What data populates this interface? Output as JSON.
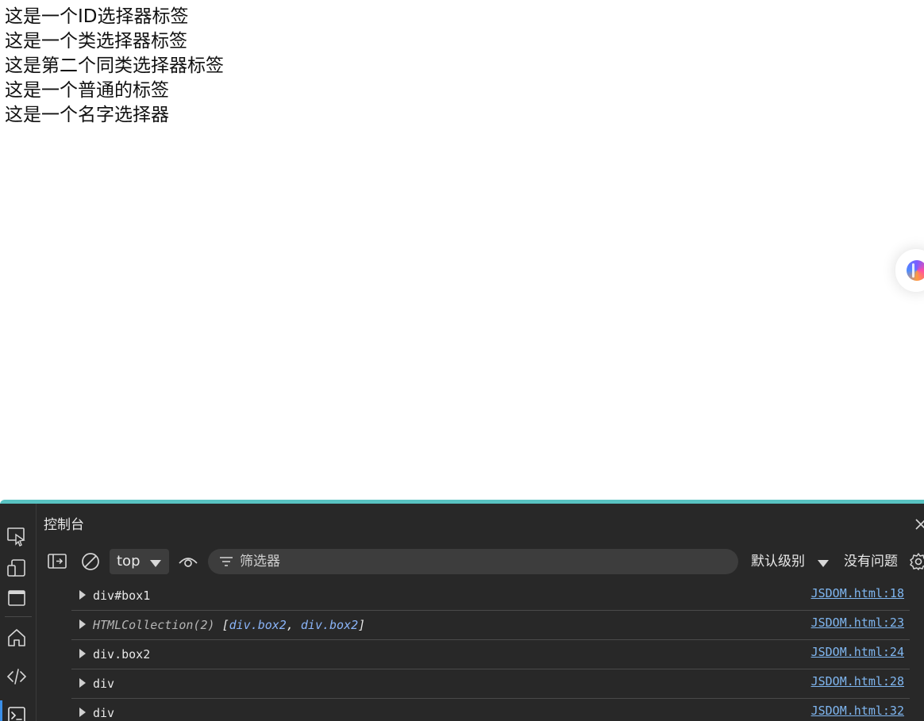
{
  "page": {
    "lines": [
      "这是一个ID选择器标签",
      "这是一个类选择器标签",
      "这是第二个同类选择器标签",
      "这是一个普通的标签",
      "这是一个名字选择器"
    ]
  },
  "devtools": {
    "title": "控制台",
    "toolbar": {
      "context": "top",
      "filter_placeholder": "筛选器",
      "levels": "默认级别",
      "issues": "没有问题"
    },
    "logs": [
      {
        "message": "div#box1",
        "source": "JSDOM.html:18"
      },
      {
        "message_prefix": "HTMLCollection(2) ",
        "bracket_open": "[",
        "item1_tag": "div",
        "item1_cls": ".box2",
        "sep": ", ",
        "item2_tag": "div",
        "item2_cls": ".box2",
        "bracket_close": "]",
        "source": "JSDOM.html:23"
      },
      {
        "message": "div.box2",
        "source": "JSDOM.html:24"
      },
      {
        "message": "div",
        "source": "JSDOM.html:28"
      },
      {
        "message": "div",
        "source": "JSDOM.html:32"
      }
    ]
  },
  "colors": {
    "accent_border": "#58c2c1",
    "devtools_bg": "#282828",
    "link": "#7fb6f0"
  },
  "icons": {
    "activity_bar": [
      "inspect-icon",
      "device-emulation-icon",
      "window-icon",
      "home-icon",
      "code-icon",
      "console-icon"
    ],
    "toolbar": [
      "sidebar-toggle-icon",
      "clear-icon",
      "eye-icon",
      "filter-icon",
      "settings-icon"
    ]
  }
}
